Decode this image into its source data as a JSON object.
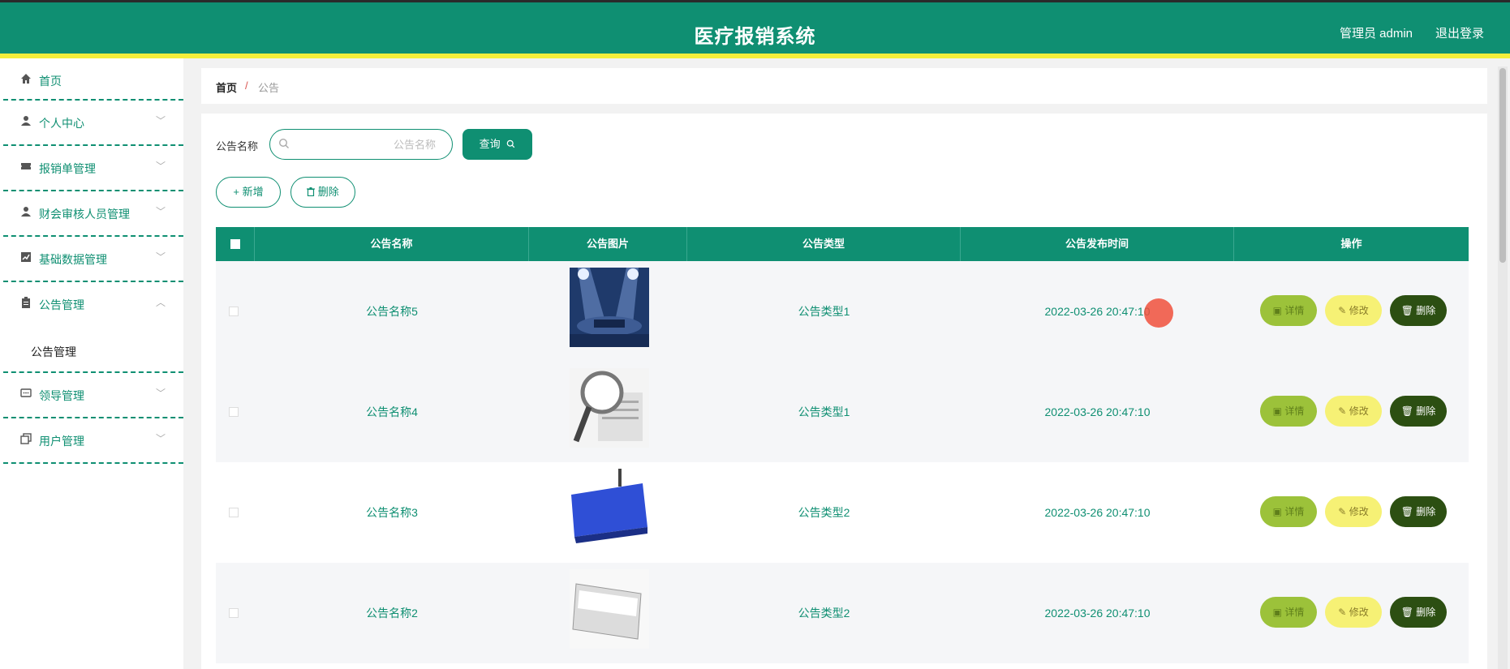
{
  "header": {
    "title": "医疗报销系统",
    "user": "管理员 admin",
    "logout": "退出登录"
  },
  "sidebar": {
    "items": [
      {
        "label": "首页",
        "icon": "home-icon"
      },
      {
        "label": "个人中心",
        "icon": "user-icon"
      },
      {
        "label": "报销单管理",
        "icon": "ticket-icon"
      },
      {
        "label": "财会审核人员管理",
        "icon": "user-icon"
      },
      {
        "label": "基础数据管理",
        "icon": "chart-icon"
      },
      {
        "label": "公告管理",
        "icon": "clipboard-icon"
      },
      {
        "label": "领导管理",
        "icon": "chat-icon"
      },
      {
        "label": "用户管理",
        "icon": "copy-icon"
      }
    ],
    "submenu": "公告管理"
  },
  "breadcrumb": {
    "home": "首页",
    "sep": "/",
    "current": "公告"
  },
  "search": {
    "label": "公告名称",
    "placeholder": "公告名称",
    "query_label": "查询"
  },
  "actions": {
    "add_label": "新增",
    "delete_label": "删除"
  },
  "table": {
    "headers": [
      "公告名称",
      "公告图片",
      "公告类型",
      "公告发布时间",
      "操作"
    ],
    "rows": [
      {
        "name": "公告名称5",
        "type": "公告类型1",
        "time": "2022-03-26 20:47:10",
        "image": "stage-lights"
      },
      {
        "name": "公告名称4",
        "type": "公告类型1",
        "time": "2022-03-26 20:47:10",
        "image": "magnifier-news"
      },
      {
        "name": "公告名称3",
        "type": "公告类型2",
        "time": "2022-03-26 20:47:10",
        "image": "news-key"
      },
      {
        "name": "公告名称2",
        "type": "公告类型2",
        "time": "2022-03-26 20:47:10",
        "image": "news-paper"
      }
    ],
    "op_labels": {
      "detail": "详情",
      "edit": "修改",
      "delete": "删除"
    }
  },
  "colors": {
    "primary": "#0f8f72",
    "accent_yellow": "#f3ee3b",
    "detail": "#9cc23a",
    "edit": "#f6f175",
    "delete": "#2c4f12"
  }
}
